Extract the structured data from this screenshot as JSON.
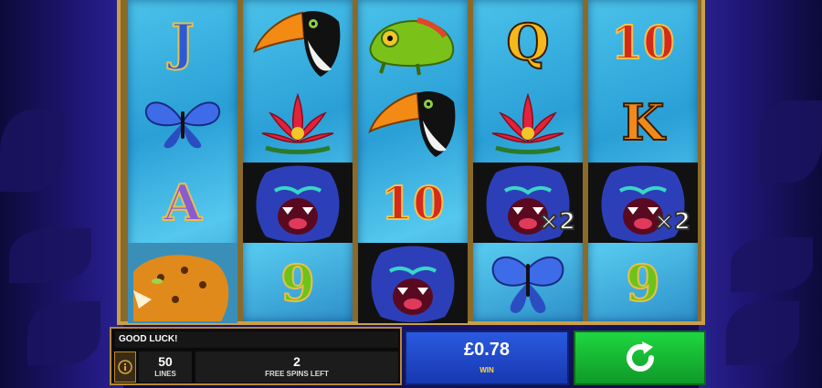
{
  "game": {
    "message": "GOOD LUCK!",
    "lines_value": "50",
    "lines_label": "LINES",
    "free_spins_value": "2",
    "free_spins_label": "FREE SPINS LEFT",
    "win_amount": "£0.78",
    "win_label": "WIN"
  },
  "reels": [
    [
      "J",
      "butterfly",
      "A",
      "jaguar"
    ],
    [
      "toucan",
      "lotus",
      "gorilla",
      "9"
    ],
    [
      "chameleon",
      "toucan",
      "10",
      "gorilla"
    ],
    [
      "Q",
      "lotus",
      "gorilla ×2",
      "butterfly"
    ],
    [
      "10",
      "K",
      "gorilla ×2",
      "9"
    ]
  ],
  "multipliers": {
    "reel4": "×2",
    "reel5": "×2"
  },
  "colors": {
    "win_box": "#1e47c8",
    "spin_button": "#18c435",
    "frame_gold": "#c9a04a"
  }
}
